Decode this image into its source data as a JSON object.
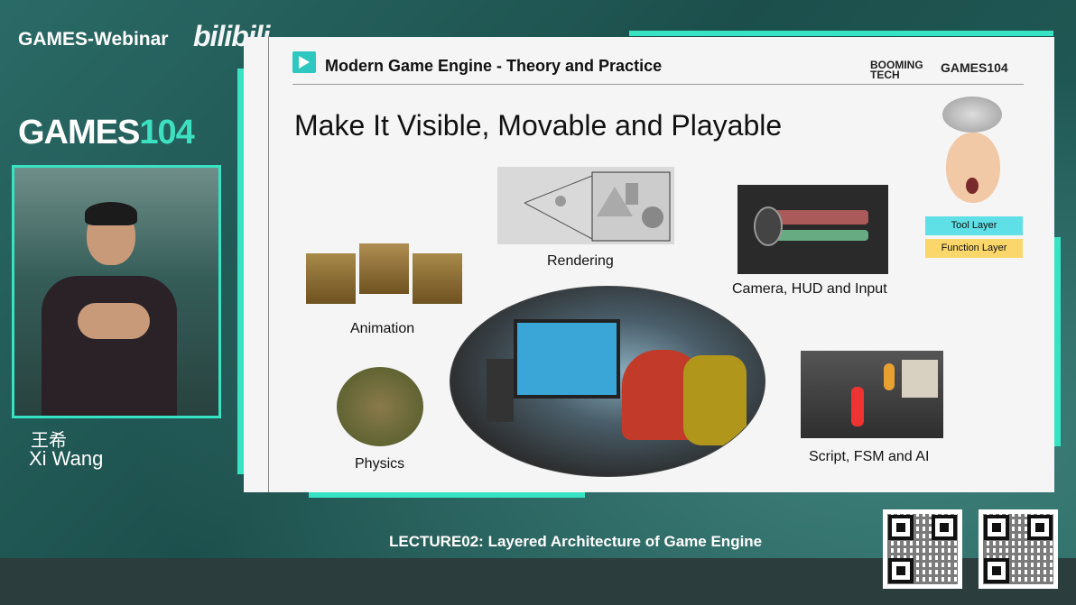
{
  "header": {
    "brand": "GAMES-Webinar",
    "platform_logo": "bilibili"
  },
  "sidebar": {
    "logo_main": "GAMES",
    "logo_num": "104",
    "speaker_cn": "王希",
    "speaker_en": "Xi Wang"
  },
  "slide": {
    "course_title": "Modern Game Engine - Theory and Practice",
    "logo_booming_1": "BOOMING",
    "logo_booming_2": "TECH",
    "logo_games": "GAMES104",
    "heading": "Make It Visible, Movable and Playable",
    "captions": {
      "rendering": "Rendering",
      "camera": "Camera, HUD and Input",
      "animation": "Animation",
      "physics": "Physics",
      "script": "Script, FSM and AI"
    },
    "layers": {
      "tool": "Tool Layer",
      "function": "Function Layer"
    }
  },
  "footer": {
    "lecture": "LECTURE02: Layered Architecture of Game Engine"
  },
  "colors": {
    "accent": "#37e3c2",
    "tool_layer": "#5fe0e6",
    "function_layer": "#fbd66a"
  }
}
